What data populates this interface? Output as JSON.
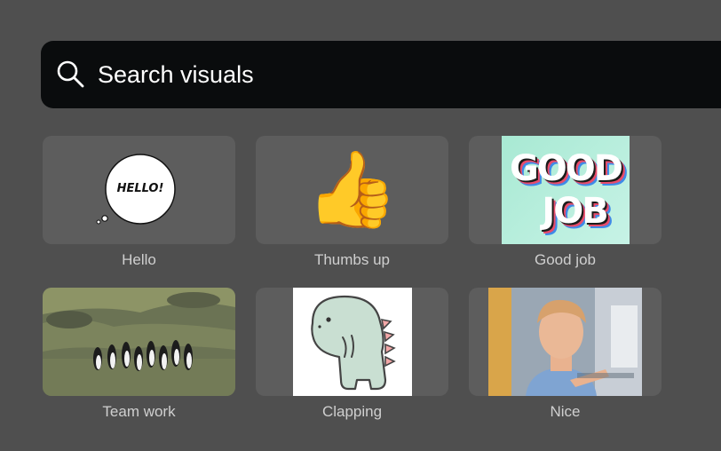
{
  "search": {
    "placeholder": "Search visuals",
    "icon": "search-icon"
  },
  "visuals": [
    {
      "label": "Hello",
      "bubble_text": "HELLO!"
    },
    {
      "label": "Thumbs up",
      "emoji": "👍"
    },
    {
      "label": "Good job",
      "art_line1": "GOOD",
      "art_line2": "JOB"
    },
    {
      "label": "Team work"
    },
    {
      "label": "Clapping"
    },
    {
      "label": "Nice"
    }
  ],
  "colors": {
    "background": "#4f4f4f",
    "search_bar": "#0a0c0d",
    "tile": "#5d5d5d",
    "label": "#cfcfcf"
  }
}
